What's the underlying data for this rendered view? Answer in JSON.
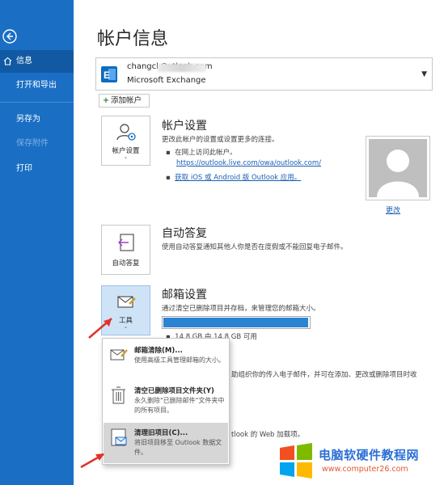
{
  "sidebar": {
    "items": [
      {
        "label": "信息",
        "active": true
      },
      {
        "label": "打开和导出"
      },
      {
        "label": "另存为"
      },
      {
        "label": "保存附件",
        "disabled": true
      },
      {
        "label": "打印"
      }
    ],
    "bg_color": "#1a6fc4"
  },
  "page": {
    "title": "帐户信息"
  },
  "account": {
    "email": "changcl               Outlook.com",
    "type": "Microsoft Exchange"
  },
  "add_account_label": "添加帐户",
  "account_settings": {
    "tile_label": "帐户设置",
    "title": "帐户设置",
    "desc": "更改此帐户的设置或设置更多的连接。",
    "bullet1": "在网上访问此帐户。",
    "link1": "https://outlook.live.com/owa/outlook.com/",
    "link2": "获取 iOS 或 Android 版 Outlook 应用。",
    "change_label": "更改"
  },
  "auto_reply": {
    "tile_label": "自动答复",
    "title": "自动答复",
    "desc": "使用自动答复通知其他人你是否在度假或不能回复电子邮件。"
  },
  "mailbox": {
    "tile_label": "工具",
    "title": "邮箱设置",
    "desc": "通过清空已删除项目并存档，来管理您的邮箱大小。",
    "usage": "14.8 GB 由 14.8 GB 可用",
    "usage_fraction": 0.995
  },
  "background_text": {
    "rules": "助组织你的传入电子邮件，并可在添加、更改或删除项目时收",
    "addins": "tlook 的 Web 加载项。"
  },
  "tools_menu": [
    {
      "title": "邮箱清除(M)...",
      "desc": "使用高级工具管理邮箱的大小。",
      "icon": "mailbox-cleanup-icon"
    },
    {
      "title": "清空已删除项目文件夹(Y)",
      "desc": "永久删除\"已删除邮件\"文件夹中的所有项目。",
      "icon": "trash-icon"
    },
    {
      "title": "清理旧项目(C)...",
      "desc": "将旧项目移至 Outlook 数据文件。",
      "icon": "archive-icon"
    }
  ],
  "watermark": {
    "title": "电脑软硬件教程网",
    "url": "www.computer26.com"
  }
}
